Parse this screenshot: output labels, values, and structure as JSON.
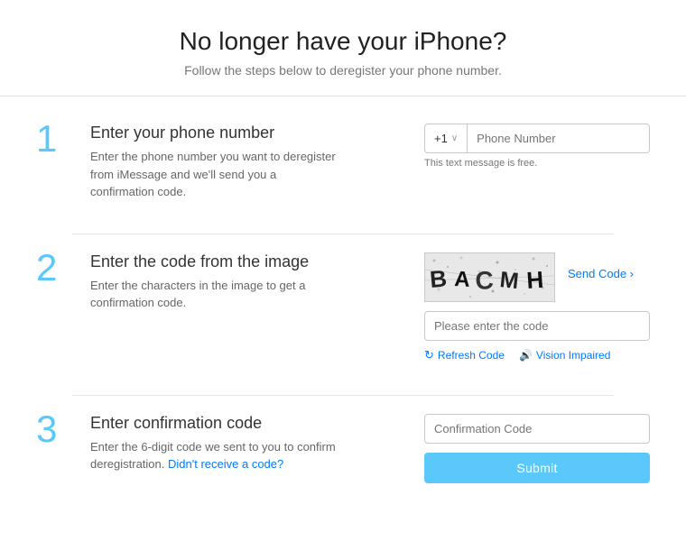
{
  "header": {
    "title": "No longer have your iPhone?",
    "subtitle": "Follow the steps below to deregister your phone number."
  },
  "steps": [
    {
      "number": "1",
      "title": "Enter your phone number",
      "description": "Enter the phone number you want to deregister from iMessage and we'll send you a confirmation code.",
      "countryCode": "+1",
      "phonePlaceholder": "Phone Number",
      "phoneHint": "This text message is free."
    },
    {
      "number": "2",
      "title": "Enter the code from the image",
      "description": "Enter the characters in the image to get a confirmation code.",
      "captchaText": "BACMH",
      "codePlaceholder": "Please enter the code",
      "refreshLabel": "Refresh Code",
      "visionLabel": "Vision Impaired",
      "sendCodeLabel": "Send Code"
    },
    {
      "number": "3",
      "title": "Enter confirmation code",
      "description": "Enter the 6-digit code we sent to you to confirm deregistration.",
      "didntReceiveText": "Didn't receive a code?",
      "confirmPlaceholder": "Confirmation Code",
      "submitLabel": "Submit"
    }
  ],
  "icons": {
    "refresh": "↻",
    "audio": "🔊",
    "chevron": "∨"
  }
}
